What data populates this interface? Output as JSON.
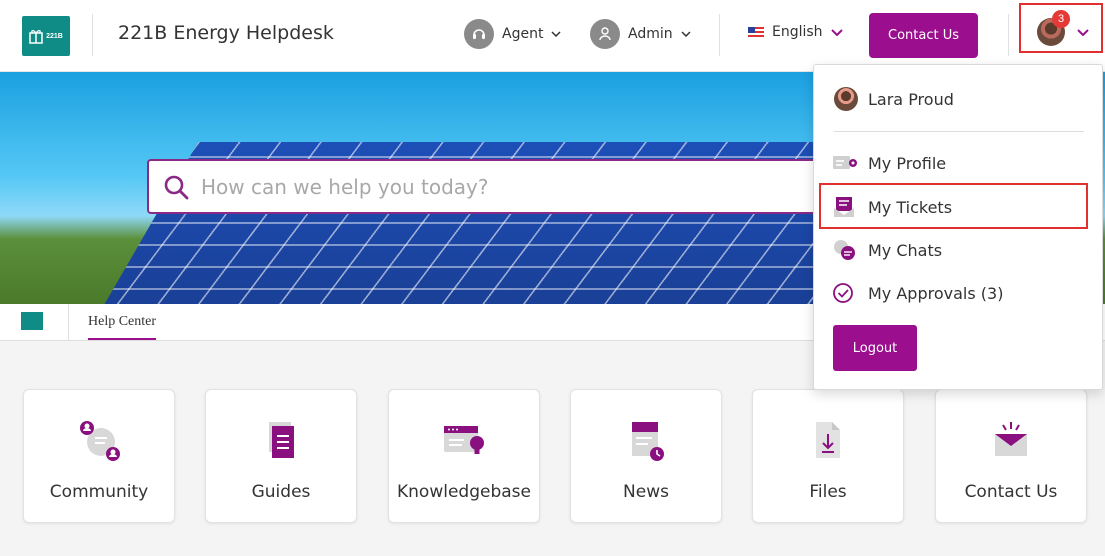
{
  "header": {
    "logo_text": "221B",
    "app_title": "221B Energy Helpdesk",
    "agent_label": "Agent",
    "admin_label": "Admin",
    "language_label": "English",
    "contact_label": "Contact Us",
    "notification_count": "3"
  },
  "hero": {
    "search_placeholder": "How can we help you today?"
  },
  "subnav": {
    "tab_label": "Help Center"
  },
  "cards": [
    {
      "label": "Community",
      "icon": "community-icon"
    },
    {
      "label": "Guides",
      "icon": "guides-icon"
    },
    {
      "label": "Knowledgebase",
      "icon": "knowledgebase-icon"
    },
    {
      "label": "News",
      "icon": "news-icon"
    },
    {
      "label": "Files",
      "icon": "files-icon"
    },
    {
      "label": "Contact Us",
      "icon": "contact-icon"
    }
  ],
  "dropdown": {
    "user_name": "Lara Proud",
    "items": [
      {
        "label": "My Profile",
        "icon": "profile-card-icon"
      },
      {
        "label": "My Tickets",
        "icon": "tickets-icon"
      },
      {
        "label": "My Chats",
        "icon": "chats-icon"
      },
      {
        "label": "My Approvals (3)",
        "icon": "check-circle-icon"
      }
    ],
    "logout_label": "Logout"
  },
  "colors": {
    "brand_purple": "#9b0f8f",
    "brand_teal": "#0f8c86",
    "highlight_red": "#e03030"
  }
}
